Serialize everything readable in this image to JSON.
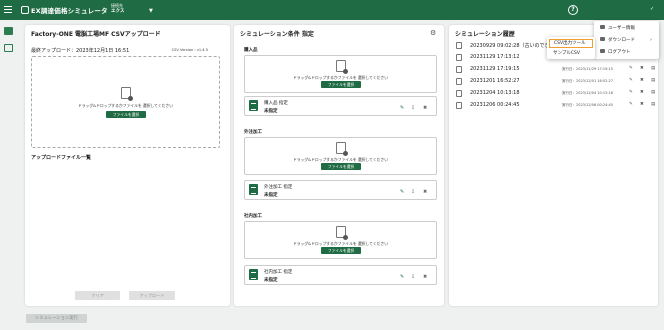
{
  "header": {
    "app_title": "EX調達価格シミュレータ",
    "connection_label": "接続先",
    "connection_value": "エクス",
    "help_symbol": "?"
  },
  "upload_panel": {
    "title": "Factory-ONE 電脳工場MF CSVアップロード",
    "last_upload": "最終アップロード：2023年12月1日 16:51",
    "csv_version": "CSV Version : v1.4.5",
    "drop_text": "ドラッグ&ドロップするかファイルを 選択してください",
    "select_button": "ファイルを選択",
    "file_list_label": "アップロードファイル一覧",
    "clear_button": "クリア",
    "upload_button": "アップロード"
  },
  "conditions_panel": {
    "title": "シミュレーション条件 指定",
    "sections": [
      {
        "label": "購入品",
        "drop_text": "ドラッグ&ドロップするかファイルを 選択してください",
        "button": "ファイルを選択",
        "file_name": "購入品 指定",
        "status": "未指定"
      },
      {
        "label": "外注加工",
        "drop_text": "ドラッグ&ドロップするかファイルを 選択してください",
        "button": "ファイルを選択",
        "file_name": "外注加工 指定",
        "status": "未指定"
      },
      {
        "label": "社内加工",
        "drop_text": "ドラッグ&ドロップするかファイルを 選択してください",
        "button": "ファイルを選択",
        "file_name": "社内加工 指定",
        "status": "未指定"
      }
    ]
  },
  "history_panel": {
    "title": "シミュレーション履歴",
    "rows": [
      {
        "date": "20230929 09:02:28（古いのでき…",
        "run": ""
      },
      {
        "date": "20231129 17:13:12",
        "run": ""
      },
      {
        "date": "20231129 17:19:15",
        "run": "実行日：2023/11/29 17:19:15"
      },
      {
        "date": "20231201 16:52:27",
        "run": "実行日：2023/12/01 16:52:27"
      },
      {
        "date": "20231204 10:13:18",
        "run": "実行日：2023/12/04 10:13:18"
      },
      {
        "date": "20231206 00:24:45",
        "run": "実行日：2023/12/06 00:24:45"
      }
    ]
  },
  "simulate_button": "シミュレーション実行",
  "user_menu": {
    "items": [
      "ユーザー情報",
      "ダウンロード",
      "ログアウト"
    ],
    "submenu": [
      "CSV出力ツール",
      "サンプルCSV"
    ]
  }
}
